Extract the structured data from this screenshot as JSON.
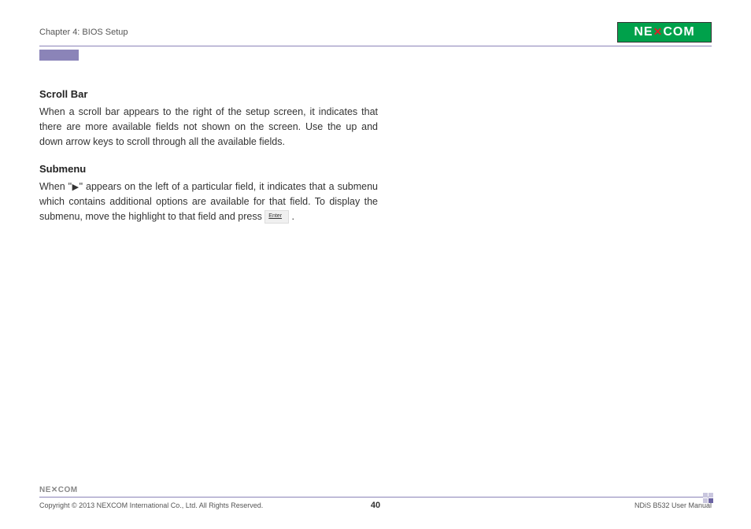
{
  "header": {
    "chapter": "Chapter 4: BIOS Setup",
    "logo_text": "NE COM"
  },
  "sections": [
    {
      "title": "Scroll Bar",
      "body": "When a scroll bar appears to the right of the setup screen, it indicates that there are more available fields not shown on the screen. Use the up and down arrow keys to scroll through all the available fields."
    },
    {
      "title": "Submenu",
      "body_pre": "When \"",
      "body_mid": "\" appears on the left of a particular field, it indicates that a submenu which contains additional options are available for that field. To display the submenu, move the highlight to that field and press ",
      "body_post": " .",
      "triangle": "▶",
      "key_label": "Enter"
    }
  ],
  "footer": {
    "logo_text": "NE✕COM",
    "copyright": "Copyright © 2013 NEXCOM International Co., Ltd. All Rights Reserved.",
    "page_number": "40",
    "manual": "NDiS B532 User Manual"
  }
}
